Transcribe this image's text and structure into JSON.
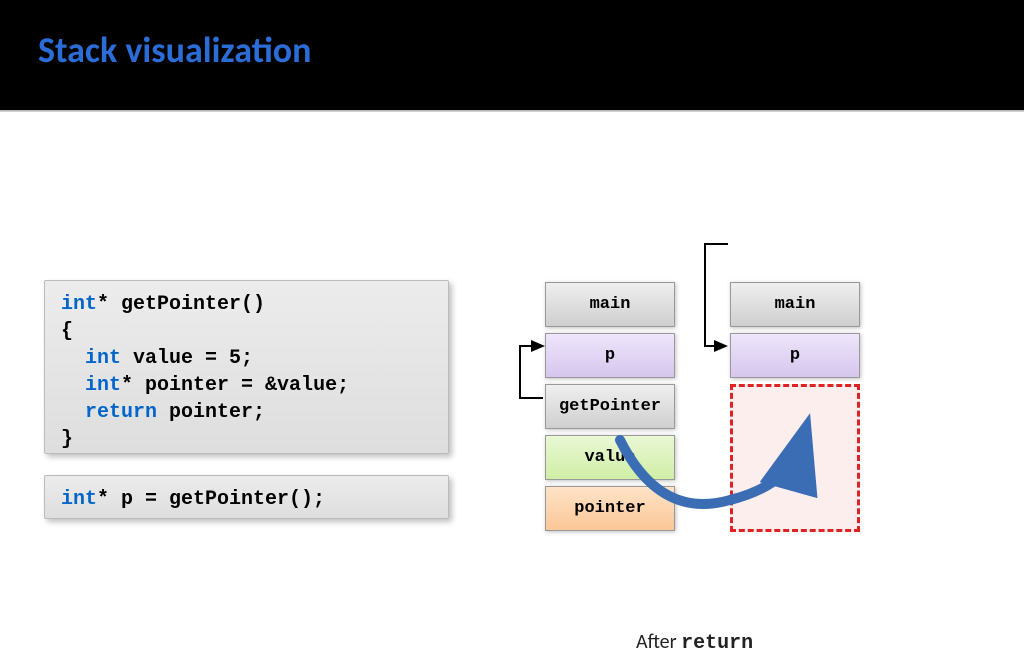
{
  "title": "Stack visualization",
  "code1": {
    "l1a": "int",
    "l1b": "* getPointer()",
    "l2": "{",
    "l3a": "int",
    "l3b": " value = 5;",
    "l4a": "int",
    "l4b": "* pointer = &value;",
    "l5a": "return",
    "l5b": " pointer;",
    "l6": "}"
  },
  "code2": {
    "a": "int",
    "b": "* p = getPointer();"
  },
  "stack1": {
    "c0": "main",
    "c1": "p",
    "c2": "getPointer",
    "c3": "value",
    "c4": "pointer"
  },
  "stack2": {
    "c0": "main",
    "c1": "p"
  },
  "after": {
    "label": "After ",
    "kw": "return"
  }
}
